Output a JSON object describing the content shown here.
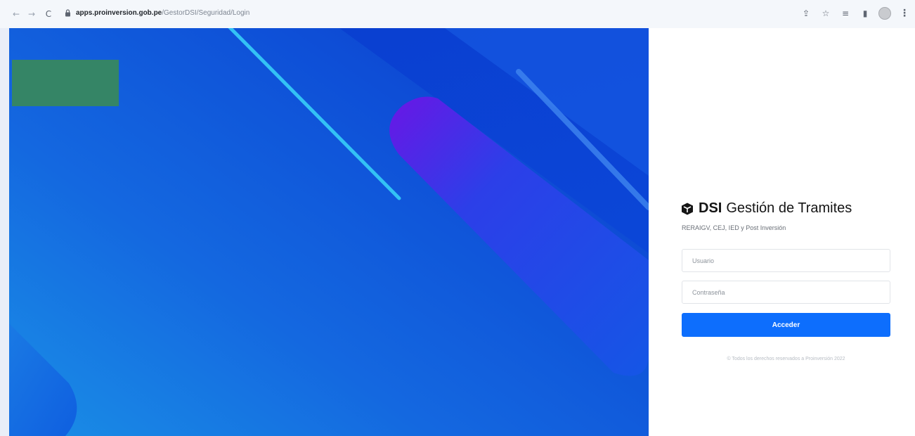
{
  "browser": {
    "back_icon": "←",
    "forward_icon": "→",
    "reload_icon": "C",
    "url_host": "apps.proinversion.gob.pe",
    "url_path": "/GestorDSI/Seguridad/Login",
    "share_icon": "⇪",
    "star_icon": "☆",
    "reading_list_icon": "≡",
    "sidepanel_icon": "▮",
    "menu_icon": "⋮"
  },
  "login": {
    "brand_short": "DSI",
    "brand_title": "Gestión de Tramites",
    "subtitle": "RERAIGV, CEJ, IED y Post Inversión",
    "username_placeholder": "Usuario",
    "password_placeholder": "Contraseña",
    "submit_label": "Acceder",
    "footer": "© Todos los derechos reservados a Proinversión 2022"
  },
  "colors": {
    "accent": "#0d6efd",
    "hero_primary": "#1468e0",
    "hero_dark": "#0a3bc7",
    "highlight_cyan": "#33c2f5",
    "highlight_purple": "#6a16e6",
    "placeholder_block": "#358566"
  }
}
